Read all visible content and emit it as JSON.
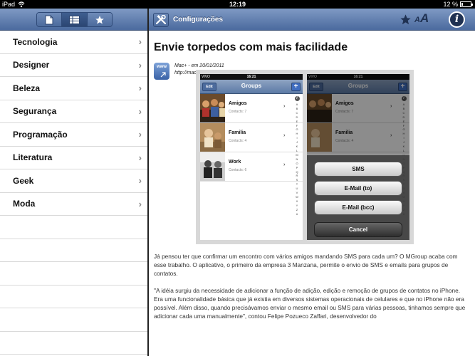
{
  "status_bar": {
    "carrier": "iPad",
    "time": "12:19",
    "battery": "12 %",
    "battery_level": 0.12
  },
  "sidebar": {
    "segments": [
      {
        "icon": "document-icon",
        "active": false
      },
      {
        "icon": "grid-list-icon",
        "active": true
      },
      {
        "icon": "star-icon",
        "active": false
      }
    ],
    "items": [
      {
        "label": "Tecnologia"
      },
      {
        "label": "Designer"
      },
      {
        "label": "Beleza"
      },
      {
        "label": "Segurança"
      },
      {
        "label": "Programação"
      },
      {
        "label": "Literatura"
      },
      {
        "label": "Geek"
      },
      {
        "label": "Moda"
      }
    ]
  },
  "detail": {
    "toolbar": {
      "config_label": "Configurações",
      "font_small": "A",
      "font_large": "A",
      "info": "i"
    },
    "article": {
      "title": "Envie torpedos com mais facilidade",
      "site_icon_text": "www",
      "byline": "Mac+ - em 20/01/2011",
      "url": "http://macmais.terra.com.br/mac-cms",
      "paragraph1": "Já pensou ter que confirmar um encontro com vários amigos mandando SMS para cada um? O MGroup acaba com esse trabalho. O aplicativo, o primeiro da empresa 3 Manzana, permite o envio de SMS e emails para grupos de contatos.",
      "paragraph2": "\"A idéia surgiu da necessidade de adicionar a função de adição, edição e remoção de grupos de contatos no iPhone. Era uma funcionalidade básica que já existia em diversos sistemas operacionais de celulares e que no iPhone não era possível. Além disso, quando precisávamos enviar o mesmo email ou SMS para várias pessoas, tinhamos sempre que adicionar cada uma manualmente\", contou Felipe Pozueco Zaffari, desenvolvedor do"
    },
    "embedded_image": {
      "carrier": "VIVO",
      "time": "16:21",
      "edit_label": "Edit",
      "nav_title": "Groups",
      "plus_label": "+",
      "index_info": "i",
      "index_letters": [
        "A",
        "B",
        "C",
        "D",
        "E",
        "F",
        "G",
        "H",
        "I",
        "J",
        "K",
        "L",
        "M",
        "N",
        "O",
        "P",
        "Q",
        "R",
        "S",
        "T",
        "U",
        "V",
        "W",
        "X",
        "Y",
        "Z",
        "#"
      ],
      "groups": [
        {
          "name": "Amigos",
          "contacts": "Contacts: 7"
        },
        {
          "name": "Familia",
          "contacts": "Contacts: 4"
        },
        {
          "name": "Work",
          "contacts": "Contacts: 6"
        }
      ],
      "action_sheet": {
        "sms": "SMS",
        "email_to": "E-Mail (to)",
        "email_bcc": "E-Mail (bcc)",
        "cancel": "Cancel"
      }
    }
  }
}
